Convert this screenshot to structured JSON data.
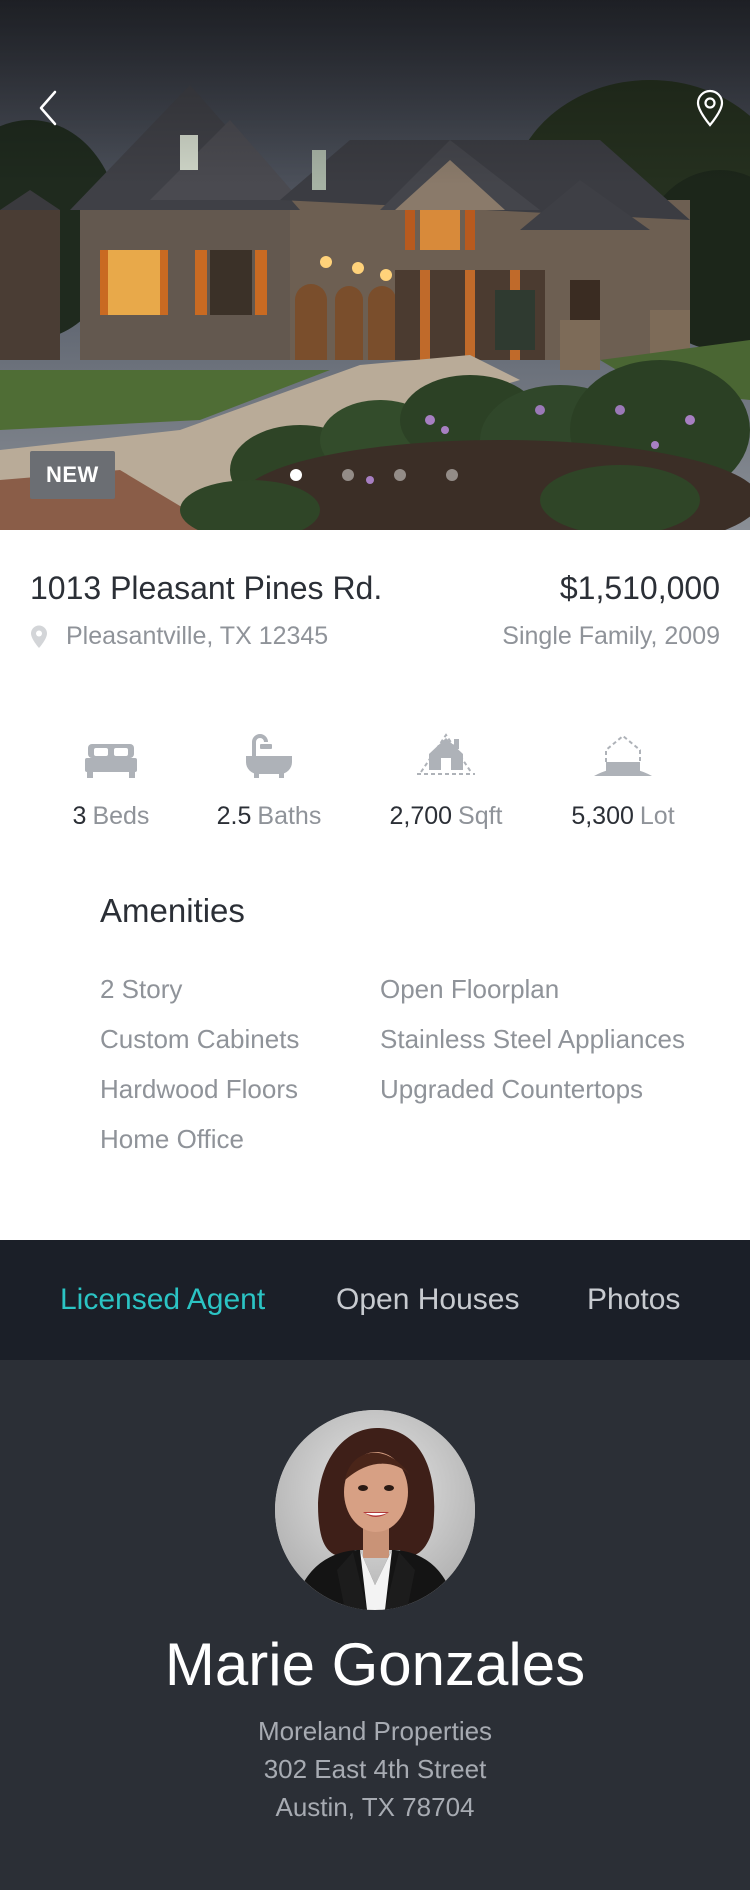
{
  "hero": {
    "badge": "NEW",
    "slide_count": 4,
    "active_slide": 1
  },
  "listing": {
    "address": "1013 Pleasant Pines Rd.",
    "price": "$1,510,000",
    "city": "Pleasantville, TX 12345",
    "type": "Single Family, 2009"
  },
  "stats": [
    {
      "value": "3",
      "unit": "Beds",
      "icon": "bed-icon"
    },
    {
      "value": "2.5",
      "unit": "Baths",
      "icon": "bathtub-icon"
    },
    {
      "value": "2,700",
      "unit": "Sqft",
      "icon": "house-icon"
    },
    {
      "value": "5,300",
      "unit": "Lot",
      "icon": "lot-icon"
    }
  ],
  "amenities": {
    "title": "Amenities",
    "left": [
      "2 Story",
      "Custom Cabinets",
      "Hardwood Floors",
      "Home Office"
    ],
    "right": [
      "Open Floorplan",
      "Stainless Steel Appliances",
      "Upgraded Countertops"
    ]
  },
  "tabs": [
    {
      "label": "Licensed Agent",
      "active": true
    },
    {
      "label": "Open Houses",
      "active": false
    },
    {
      "label": "Photos",
      "active": false
    }
  ],
  "agent": {
    "name": "Marie Gonzales",
    "company": "Moreland Properties",
    "street": "302 East 4th Street",
    "city": "Austin, TX 78704"
  },
  "colors": {
    "accent": "#2bc4c4",
    "dark_bg": "#2b2f36",
    "tab_bg": "#1b1f28"
  }
}
